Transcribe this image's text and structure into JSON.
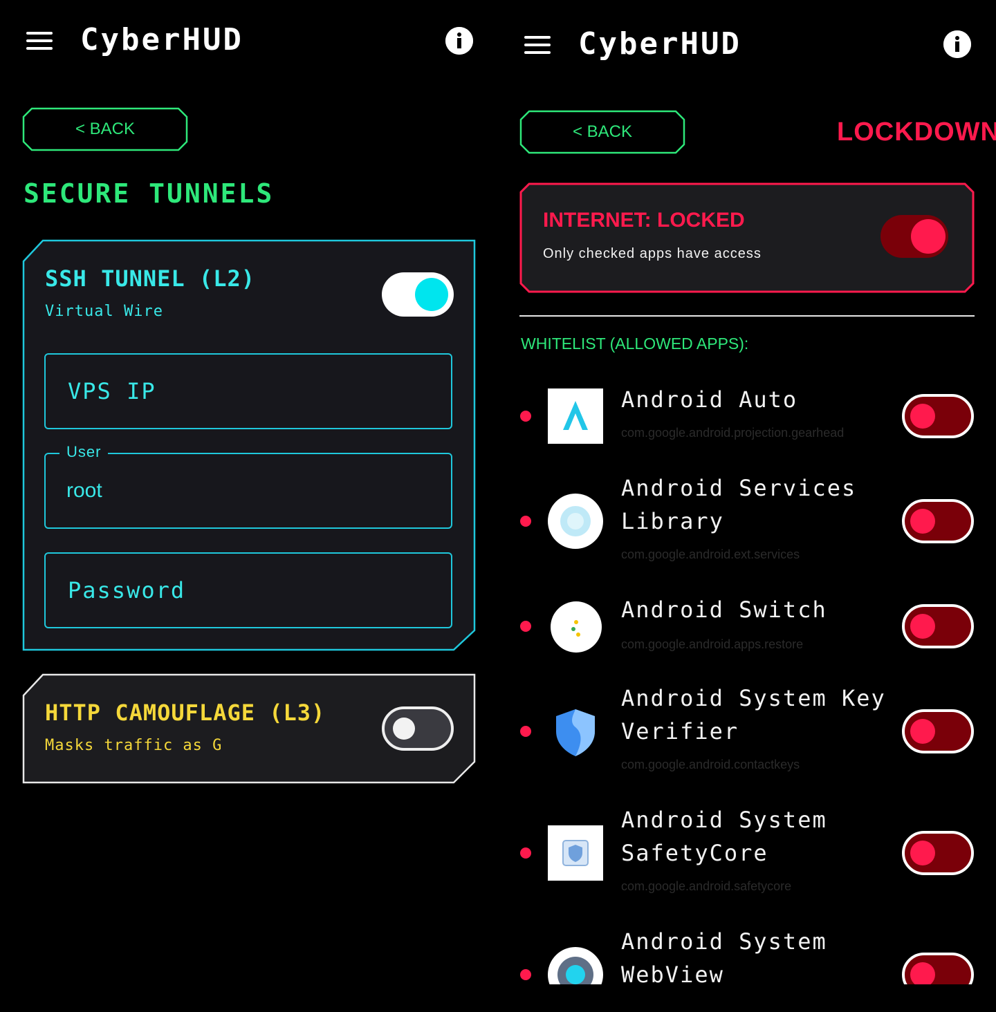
{
  "colors": {
    "accent_green": "#2ee87a",
    "accent_cyan": "#1fc8dc",
    "accent_yellow": "#f5d83a",
    "accent_red": "#ff1a4d",
    "background": "#000000"
  },
  "left": {
    "app_bar": {
      "title": "CyberHUD",
      "menu_icon": "menu-icon",
      "info_icon": "info-icon"
    },
    "back_label": "<  BACK",
    "section_title": "SECURE TUNNELS",
    "ssh": {
      "title": "SSH TUNNEL (L2)",
      "subtitle": "Virtual Wire",
      "enabled": true,
      "fields": {
        "vps_ip_placeholder": "VPS IP",
        "user_label": "User",
        "user_value": "root",
        "password_placeholder": "Password"
      }
    },
    "http": {
      "title": "HTTP CAMOUFLAGE (L3)",
      "subtitle": "Masks traffic as G",
      "enabled": false
    }
  },
  "right": {
    "app_bar": {
      "title": "CyberHUD",
      "menu_icon": "menu-icon",
      "info_icon": "info-icon"
    },
    "back_label": "<  BACK",
    "mode_label": "LOCKDOWN",
    "internet_card": {
      "title": "INTERNET: LOCKED",
      "subtitle": "Only checked apps have access",
      "enabled": true
    },
    "whitelist_header": "WHITELIST (ALLOWED APPS):",
    "apps": [
      {
        "name": "Android Auto",
        "package": "com.google.android.projection.gearhead",
        "icon": "android-auto-icon",
        "allowed": false
      },
      {
        "name": "Android Services Library",
        "package": "com.google.android.ext.services",
        "icon": "services-library-icon",
        "allowed": false
      },
      {
        "name": "Android Switch",
        "package": "com.google.android.apps.restore",
        "icon": "android-switch-icon",
        "allowed": false
      },
      {
        "name": "Android System Key Verifier",
        "package": "com.google.android.contactkeys",
        "icon": "key-verifier-shield-icon",
        "allowed": false
      },
      {
        "name": "Android System SafetyCore",
        "package": "com.google.android.safetycore",
        "icon": "safetycore-chip-icon",
        "allowed": false
      },
      {
        "name": "Android System WebView",
        "package": "",
        "icon": "webview-gear-icon",
        "allowed": false
      }
    ]
  }
}
